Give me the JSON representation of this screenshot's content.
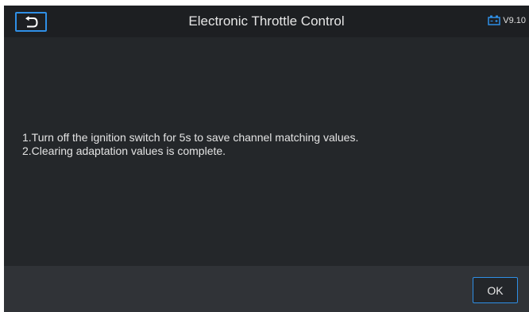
{
  "header": {
    "title": "Electronic Throttle Control",
    "back_icon": "back-arrow-icon",
    "battery_icon": "battery-icon",
    "version": "V9.10"
  },
  "message": {
    "lines": [
      "1.Turn off the ignition switch for 5s to save channel matching values.",
      "2.Clearing adaptation values is complete."
    ]
  },
  "footer": {
    "ok_label": "OK"
  },
  "colors": {
    "accent": "#2f8fe6",
    "background": "#24272a",
    "header_background": "#1d1f22",
    "footer_background": "#303337",
    "text": "#e4e4e4"
  }
}
